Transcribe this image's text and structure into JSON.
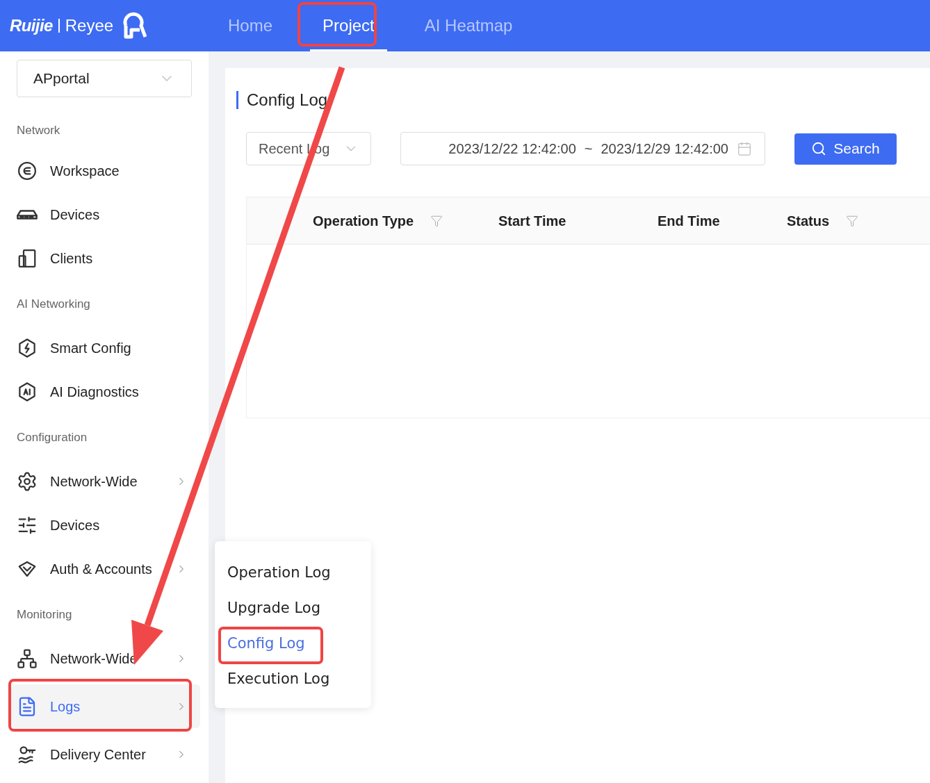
{
  "header": {
    "brand": "Ruijie",
    "sub_brand": "Reyee",
    "tabs": [
      {
        "label": "Home",
        "selected": false
      },
      {
        "label": "Project",
        "selected": true
      },
      {
        "label": "AI Heatmap",
        "selected": false
      }
    ]
  },
  "project_select": {
    "value": "APportal"
  },
  "sidebar": {
    "sections": [
      {
        "title": "Network",
        "items": [
          {
            "label": "Workspace",
            "kind": "workspace",
            "submenu": false,
            "selected": false
          },
          {
            "label": "Devices",
            "kind": "switch",
            "submenu": false,
            "selected": false
          },
          {
            "label": "Clients",
            "kind": "clients",
            "submenu": false,
            "selected": false
          }
        ]
      },
      {
        "title": "AI Networking",
        "items": [
          {
            "label": "Smart Config",
            "kind": "smart",
            "submenu": false,
            "selected": false
          },
          {
            "label": "AI Diagnostics",
            "kind": "ai",
            "submenu": false,
            "selected": false
          }
        ]
      },
      {
        "title": "Configuration",
        "items": [
          {
            "label": "Network-Wide",
            "kind": "gear",
            "submenu": true,
            "selected": false
          },
          {
            "label": "Devices",
            "kind": "sliders",
            "selected": false
          },
          {
            "label": "Auth & Accounts",
            "kind": "shield",
            "submenu": true,
            "selected": false
          }
        ]
      },
      {
        "title": "Monitoring",
        "items": [
          {
            "label": "Network-Wide",
            "kind": "topology",
            "submenu": true,
            "selected": false
          },
          {
            "label": "Logs",
            "kind": "log",
            "submenu": true,
            "selected": true
          },
          {
            "label": "Delivery Center",
            "kind": "delivery",
            "submenu": true,
            "selected": false
          }
        ]
      }
    ]
  },
  "page": {
    "title": "Config Log",
    "log_type": "Recent Log",
    "date_start": "2023/12/22 12:42:00",
    "date_separator": "~",
    "date_end": "2023/12/29 12:42:00",
    "search_button": "Search",
    "table": {
      "columns": [
        {
          "label": "Operation Type",
          "filter": true
        },
        {
          "label": "Start Time",
          "filter": false
        },
        {
          "label": "End Time",
          "filter": false
        },
        {
          "label": "Status",
          "filter": true
        }
      ]
    }
  },
  "submenu": {
    "items": [
      {
        "label": "Operation Log",
        "selected": false
      },
      {
        "label": "Upgrade Log",
        "selected": false
      },
      {
        "label": "Config Log",
        "selected": true
      },
      {
        "label": "Execution Log",
        "selected": false
      }
    ]
  }
}
